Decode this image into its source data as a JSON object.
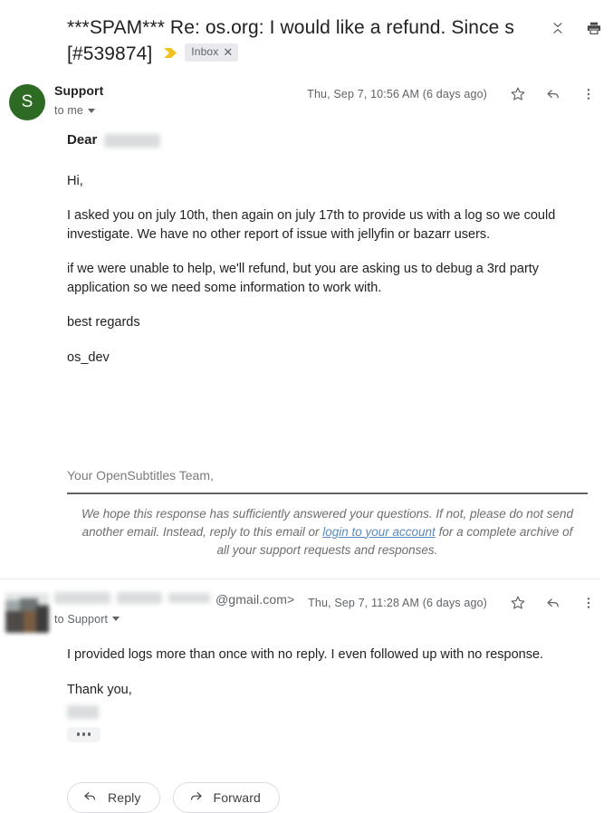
{
  "thread": {
    "subject": "***SPAM*** Re: os.org: I would like a refund. Since s [#539874]",
    "important_marker_icon": "important-chevron-icon",
    "label": {
      "name": "Inbox",
      "remove_icon": "close-x-icon"
    },
    "actions": {
      "collapse_all_icon": "collapse-all-icon",
      "print_icon": "print-icon"
    }
  },
  "messages": [
    {
      "avatar": {
        "type": "initial",
        "initial": "S",
        "color": "#2d6a24"
      },
      "sender": "Support",
      "sender_redacted": false,
      "recipient": "to me",
      "timestamp": "Thu, Sep 7, 10:56 AM (6 days ago)",
      "star_icon": "star-outline-icon",
      "reply_icon": "reply-arrow-icon",
      "more_icon": "more-vertical-icon",
      "body": {
        "greeting_label": "Dear",
        "greeting_name_redacted": true,
        "paragraphs": [
          "Hi,",
          "I asked you on july 10th, then again on july 17th to provide us with a log so we could investigate. We have no other report of issue with jellyfin or bazarr users.",
          "if we were unable to help, we'll refund, but you are asking us to debug a 3rd party application so we need some information to work with.",
          "best regards",
          "os_dev"
        ],
        "signature": "Your OpenSubtitles Team,",
        "disclaimer_before": "We hope this response has sufficiently answered your questions. If not, please do not send another email. Instead, reply to this email or ",
        "disclaimer_link": "login to your account",
        "disclaimer_after": " for a complete archive of all your support requests and responses."
      }
    },
    {
      "avatar": {
        "type": "photo"
      },
      "sender_redacted": true,
      "sender_email_tail": "@gmail.com>",
      "recipient": "to Support",
      "timestamp": "Thu, Sep 7, 11:28 AM (6 days ago)",
      "star_icon": "star-outline-icon",
      "reply_icon": "reply-arrow-icon",
      "more_icon": "more-vertical-icon",
      "body": {
        "paragraphs": [
          "I provided logs more than once with no reply. I even followed up with no response.",
          "Thank you,"
        ],
        "signature_redacted": true,
        "trimmed_content_icon": "show-trimmed-content-icon"
      }
    }
  ],
  "footer": {
    "reply_label": "Reply",
    "reply_icon": "reply-arrow-icon",
    "forward_label": "Forward",
    "forward_icon": "forward-arrow-icon"
  }
}
